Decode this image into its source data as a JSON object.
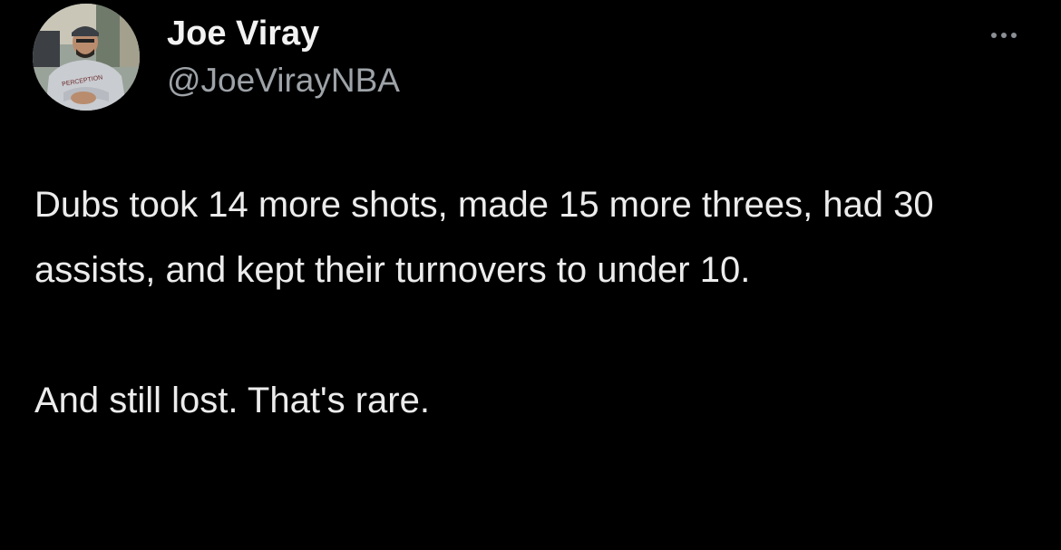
{
  "tweet": {
    "author": {
      "display_name": "Joe Viray",
      "handle": "@JoeVirayNBA",
      "avatar_icon": "profile-photo",
      "avatar_shirt_text": "PERCEPTION"
    },
    "more_icon": "ellipsis-icon",
    "text": {
      "paragraph_1": "Dubs took 14 more shots, made 15 more threes, had 30 assists, and kept their turnovers to under 10.",
      "paragraph_2": "And still lost. That's rare."
    },
    "colors": {
      "background": "#000000",
      "name": "#f2f2f2",
      "handle": "#9ea3a8",
      "body": "#ececec"
    }
  }
}
